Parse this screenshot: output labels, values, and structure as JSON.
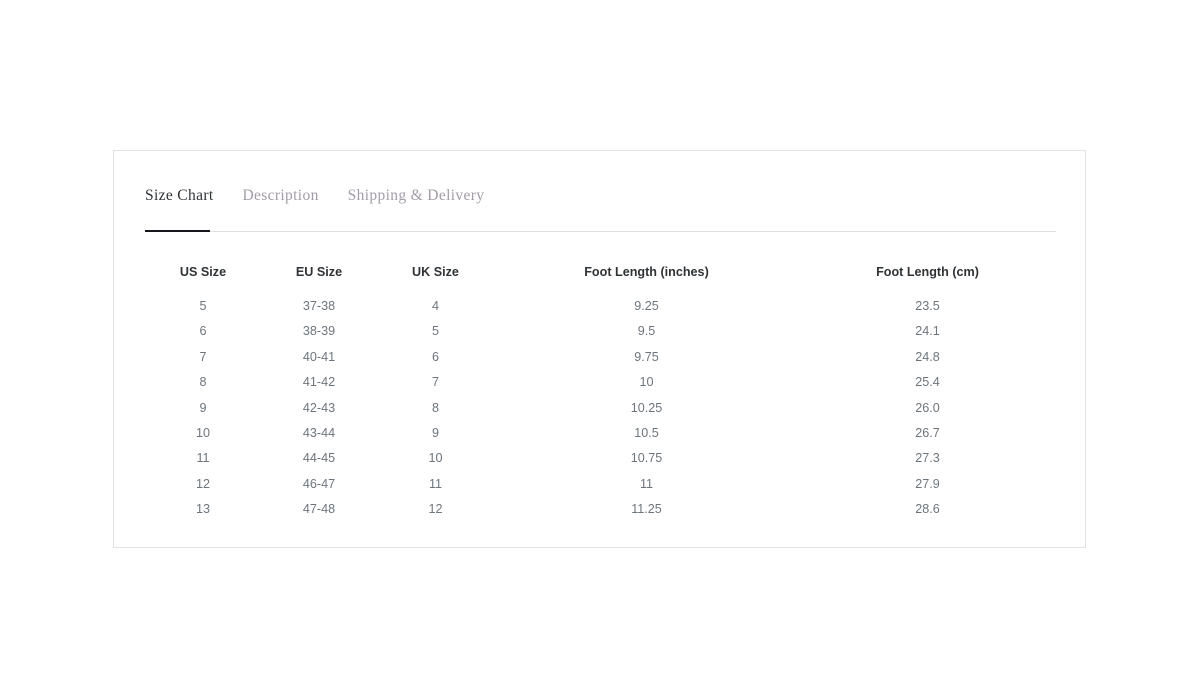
{
  "card": {
    "tabs": [
      {
        "label": "Size Chart",
        "active": true
      },
      {
        "label": "Description",
        "active": false
      },
      {
        "label": "Shipping & Delivery",
        "active": false
      }
    ],
    "table": {
      "headers": [
        "US Size",
        "EU Size",
        "UK Size",
        "Foot Length (inches)",
        "Foot Length (cm)"
      ],
      "rows": [
        [
          "5",
          "37-38",
          "4",
          "9.25",
          "23.5"
        ],
        [
          "6",
          "38-39",
          "5",
          "9.5",
          "24.1"
        ],
        [
          "7",
          "40-41",
          "6",
          "9.75",
          "24.8"
        ],
        [
          "8",
          "41-42",
          "7",
          "10",
          "25.4"
        ],
        [
          "9",
          "42-43",
          "8",
          "10.25",
          "26.0"
        ],
        [
          "10",
          "43-44",
          "9",
          "10.5",
          "26.7"
        ],
        [
          "11",
          "44-45",
          "10",
          "10.75",
          "27.3"
        ],
        [
          "12",
          "46-47",
          "11",
          "11",
          "27.9"
        ],
        [
          "13",
          "47-48",
          "12",
          "11.25",
          "28.6"
        ]
      ]
    }
  },
  "colors": {
    "page_background": "#ffffff",
    "card_background": "#ffffff",
    "card_border": "#e2e2e2",
    "tab_active_text": "#2f3336",
    "tab_inactive_text": "#a39ca8",
    "tab_active_underline": "#15171a",
    "divider": "#e0e0e0",
    "table_header_text": "#2f3336",
    "table_cell_text": "#6d757c"
  }
}
